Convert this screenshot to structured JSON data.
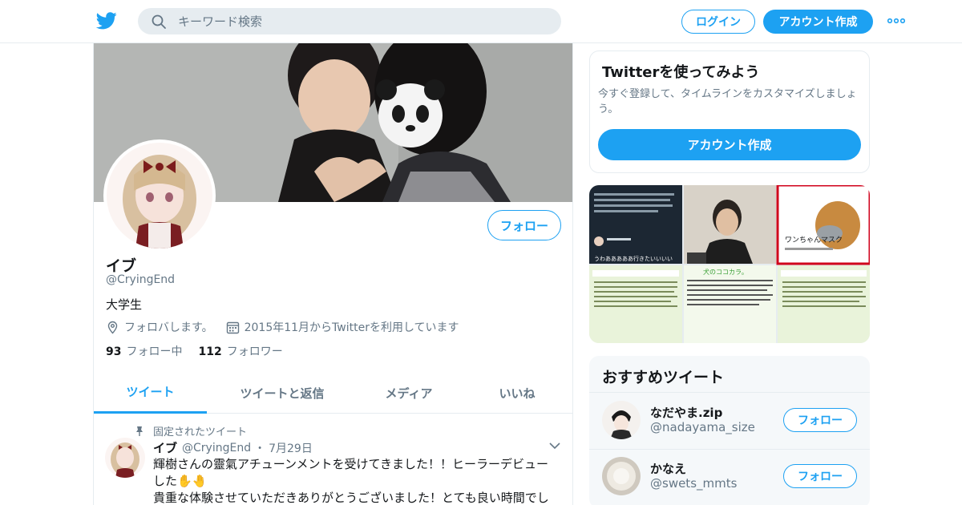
{
  "topbar": {
    "search_placeholder": "キーワード検索",
    "login_label": "ログイン",
    "signup_label": "アカウント作成",
    "brand_color": "#1da1f2"
  },
  "profile": {
    "name": "イブ",
    "handle": "@CryingEnd",
    "bio": "大学生",
    "location": "フォロバします。",
    "joined": "2015年11月からTwitterを利用しています",
    "following_count": "93",
    "following_label": "フォロー中",
    "followers_count": "112",
    "followers_label": "フォロワー",
    "follow_label": "フォロー"
  },
  "tabs": [
    {
      "label": "ツイート",
      "active": true
    },
    {
      "label": "ツイートと返信",
      "active": false
    },
    {
      "label": "メディア",
      "active": false
    },
    {
      "label": "いいね",
      "active": false
    }
  ],
  "pinned_tweet": {
    "pinned_label": "固定されたツイート",
    "author_name": "イブ",
    "author_handle": "@CryingEnd",
    "separator": "・",
    "date": "7月29日",
    "text_line1": "輝樹さんの靈氣アチューンメントを受けてきました！！ヒーラーデビュー",
    "text_line2": "した✋🤚",
    "text_line3": "貴重な体験させていただきありがとうございました！とても良い時間でし"
  },
  "try_card": {
    "title": "Twitterを使ってみよう",
    "description": "今すぐ登録して、タイムラインをカスタマイズしましょう。",
    "button_label": "アカウント作成"
  },
  "media_thumbs": {
    "thumb3_caption": "ワンちゃんマスク",
    "thumb2_caption": "犬のココカラ。",
    "thumb1_caption": "うわあああああ行きたいいいい"
  },
  "recommended": {
    "title": "おすすめツイート",
    "users": [
      {
        "name": "なだやま.zip",
        "handle": "@nadayama_size",
        "follow_label": "フォロー"
      },
      {
        "name": "かなえ",
        "handle": "@swets_mmts",
        "follow_label": "フォロー"
      }
    ]
  }
}
